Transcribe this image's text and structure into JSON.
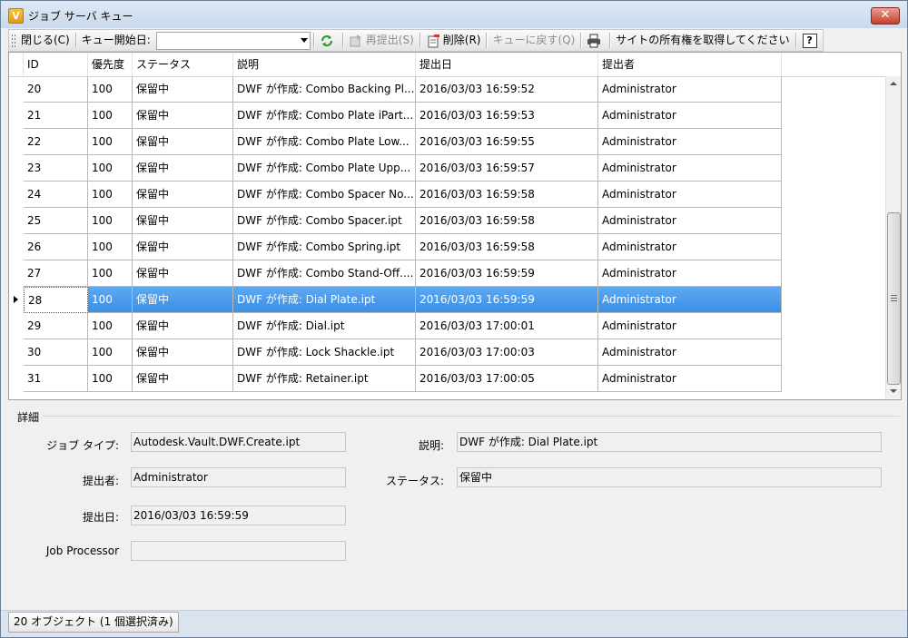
{
  "window": {
    "title": "ジョブ サーバ キュー",
    "app_icon_letter": "V",
    "close_symbol": "✕"
  },
  "toolbar": {
    "close_label": "閉じる(C)",
    "start_date_label": "キュー開始日:",
    "start_date_value": "",
    "resubmit_label": "再提出(S)",
    "delete_label": "削除(R)",
    "return_label": "キューに戻す(Q)",
    "ownership_label": "サイトの所有権を取得してください",
    "help_symbol": "?"
  },
  "grid": {
    "columns": [
      "ID",
      "優先度",
      "ステータス",
      "説明",
      "提出日",
      "提出者"
    ],
    "rows": [
      [
        "20",
        "100",
        "保留中",
        "DWF が作成: Combo Backing Pl...",
        "2016/03/03 16:59:52",
        "Administrator"
      ],
      [
        "21",
        "100",
        "保留中",
        "DWF が作成: Combo Plate iPart...",
        "2016/03/03 16:59:53",
        "Administrator"
      ],
      [
        "22",
        "100",
        "保留中",
        "DWF が作成: Combo Plate Low...",
        "2016/03/03 16:59:55",
        "Administrator"
      ],
      [
        "23",
        "100",
        "保留中",
        "DWF が作成: Combo Plate Upp...",
        "2016/03/03 16:59:57",
        "Administrator"
      ],
      [
        "24",
        "100",
        "保留中",
        "DWF が作成: Combo Spacer No...",
        "2016/03/03 16:59:58",
        "Administrator"
      ],
      [
        "25",
        "100",
        "保留中",
        "DWF が作成: Combo Spacer.ipt",
        "2016/03/03 16:59:58",
        "Administrator"
      ],
      [
        "26",
        "100",
        "保留中",
        "DWF が作成: Combo Spring.ipt",
        "2016/03/03 16:59:58",
        "Administrator"
      ],
      [
        "27",
        "100",
        "保留中",
        "DWF が作成: Combo Stand-Off....",
        "2016/03/03 16:59:59",
        "Administrator"
      ],
      [
        "28",
        "100",
        "保留中",
        "DWF が作成: Dial Plate.ipt",
        "2016/03/03 16:59:59",
        "Administrator"
      ],
      [
        "29",
        "100",
        "保留中",
        "DWF が作成: Dial.ipt",
        "2016/03/03 17:00:01",
        "Administrator"
      ],
      [
        "30",
        "100",
        "保留中",
        "DWF が作成: Lock Shackle.ipt",
        "2016/03/03 17:00:03",
        "Administrator"
      ],
      [
        "31",
        "100",
        "保留中",
        "DWF が作成: Retainer.ipt",
        "2016/03/03 17:00:05",
        "Administrator"
      ]
    ],
    "selected_id": "28"
  },
  "details": {
    "section_title": "詳細",
    "job_type_label": "ジョブ タイプ:",
    "job_type_value": "Autodesk.Vault.DWF.Create.ipt",
    "description_label": "説明:",
    "description_value": "DWF が作成: Dial Plate.ipt",
    "submitter_label": "提出者:",
    "submitter_value": "Administrator",
    "status_label": "ステータス:",
    "status_value": "保留中",
    "submit_date_label": "提出日:",
    "submit_date_value": "2016/03/03 16:59:59",
    "job_processor_label": "Job Processor",
    "job_processor_value": ""
  },
  "statusbar": {
    "text": "20 オブジェクト (1 個選択済み)"
  },
  "colors": {
    "selection": "#3b8fe5",
    "title_bar": "#c9d9ec",
    "close_button": "#c3402a"
  }
}
